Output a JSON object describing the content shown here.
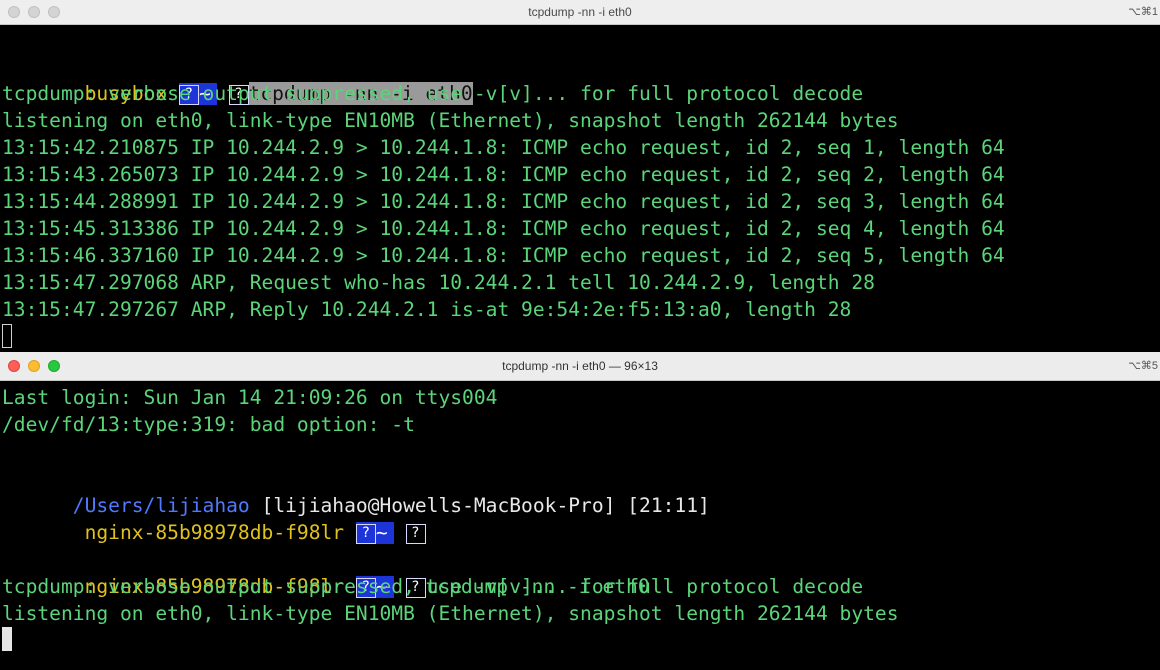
{
  "window1": {
    "title": "tcpdump -nn -i eth0",
    "shortcut": "⌥⌘1",
    "prompt_host": "busybox",
    "prompt_glyph": "?",
    "prompt_path": "~",
    "command": "tcpdump -nn -i eth0",
    "lines": [
      "tcpdump: verbose output suppressed, use -v[v]... for full protocol decode",
      "listening on eth0, link-type EN10MB (Ethernet), snapshot length 262144 bytes",
      "13:15:42.210875 IP 10.244.2.9 > 10.244.1.8: ICMP echo request, id 2, seq 1, length 64",
      "13:15:43.265073 IP 10.244.2.9 > 10.244.1.8: ICMP echo request, id 2, seq 2, length 64",
      "13:15:44.288991 IP 10.244.2.9 > 10.244.1.8: ICMP echo request, id 2, seq 3, length 64",
      "13:15:45.313386 IP 10.244.2.9 > 10.244.1.8: ICMP echo request, id 2, seq 4, length 64",
      "13:15:46.337160 IP 10.244.2.9 > 10.244.1.8: ICMP echo request, id 2, seq 5, length 64",
      "13:15:47.297068 ARP, Request who-has 10.244.2.1 tell 10.244.2.9, length 28",
      "13:15:47.297267 ARP, Reply 10.244.2.1 is-at 9e:54:2e:f5:13:a0, length 28"
    ]
  },
  "window2": {
    "title": "tcpdump -nn -i eth0 — 96×13",
    "shortcut": "⌥⌘5",
    "last_login": "Last login: Sun Jan 14 21:09:26 on ttys004",
    "error_line": "/dev/fd/13:type:319: bad option: -t",
    "cwd": "/Users/lijiahao",
    "user_host": "[lijiahao@Howells-MacBook-Pro]",
    "time": "[21:11]",
    "prompt_host": "nginx-85b98978db-f98lr",
    "prompt_glyph": "?",
    "prompt_path": "~",
    "command": "tcpdump -nn -i eth0",
    "lines": [
      "tcpdump: verbose output suppressed, use -v[v]... for full protocol decode",
      "listening on eth0, link-type EN10MB (Ethernet), snapshot length 262144 bytes"
    ]
  },
  "colors": {
    "output_text": "#5bd47a",
    "prompt_host": "#e0c21f",
    "path_segment_bg": "#1d34d8",
    "cwd": "#4f79ff"
  }
}
